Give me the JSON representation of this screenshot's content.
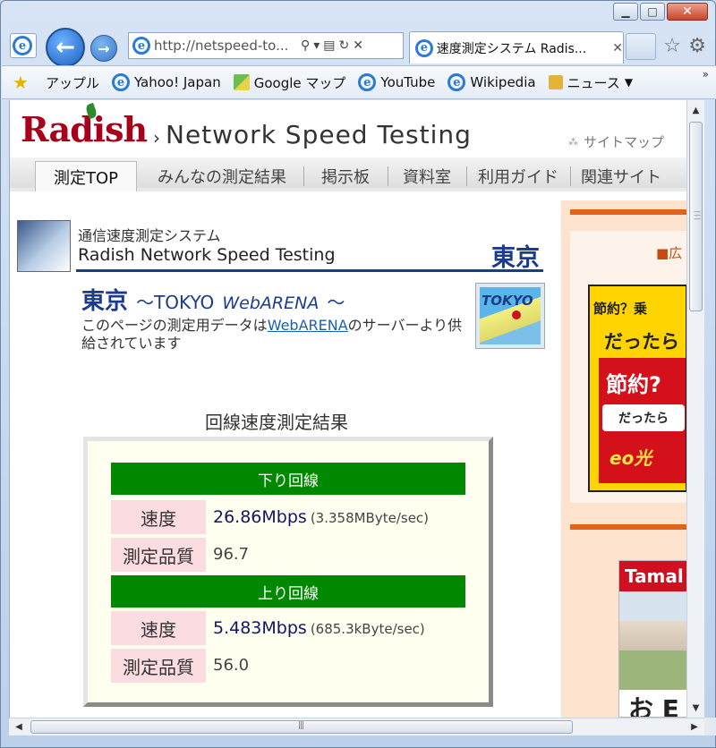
{
  "browser": {
    "address": "http://netspeed-to...",
    "tab_title": "速度測定システム Radis...",
    "favorites": [
      {
        "label": "アップル",
        "icon": "apple-icon"
      },
      {
        "label": "Yahoo! Japan",
        "icon": "ie-page-icon"
      },
      {
        "label": "Google マップ",
        "icon": "google-maps-icon"
      },
      {
        "label": "YouTube",
        "icon": "ie-page-icon"
      },
      {
        "label": "Wikipedia",
        "icon": "ie-page-icon"
      },
      {
        "label": "ニュース",
        "icon": "folder-icon"
      }
    ]
  },
  "site": {
    "logo": "Radish",
    "title": "Network Speed Testing",
    "sitemap": "サイトマップ",
    "menu": [
      "測定TOP",
      "みんなの測定結果",
      "掲示板",
      "資料室",
      "利用ガイド",
      "関連サイト"
    ]
  },
  "system": {
    "subtitle": "通信速度測定システム",
    "name": "Radish Network Speed Testing",
    "city": "東京"
  },
  "location": {
    "city": "東京",
    "tilde_open": "～TOKYO",
    "server": "WebARENA",
    "tilde_close": "～",
    "desc_pre": "このページの測定用データは",
    "desc_link": "WebARENA",
    "desc_post": "のサーバーより供給されています",
    "map_label": "TOKYO"
  },
  "result": {
    "title": "回線速度測定結果",
    "down": {
      "header": "下り回線",
      "speed_label": "速度",
      "speed": "26.86Mbps",
      "speed_sub": "(3.358MByte/sec)",
      "quality_label": "測定品質",
      "quality": "96.7"
    },
    "up": {
      "header": "上り回線",
      "speed_label": "速度",
      "speed": "5.483Mbps",
      "speed_sub": "(685.3kByte/sec)",
      "quality_label": "測定品質",
      "quality": "56.0"
    }
  },
  "sidebar": {
    "ad_label": "■広",
    "ad1": {
      "line1": "節約？乗",
      "line2": "だったら",
      "line3": "節約?",
      "bubble": "だったら",
      "brand": "eo光"
    },
    "ad2": {
      "head": "Tamal",
      "text": "お E"
    }
  }
}
